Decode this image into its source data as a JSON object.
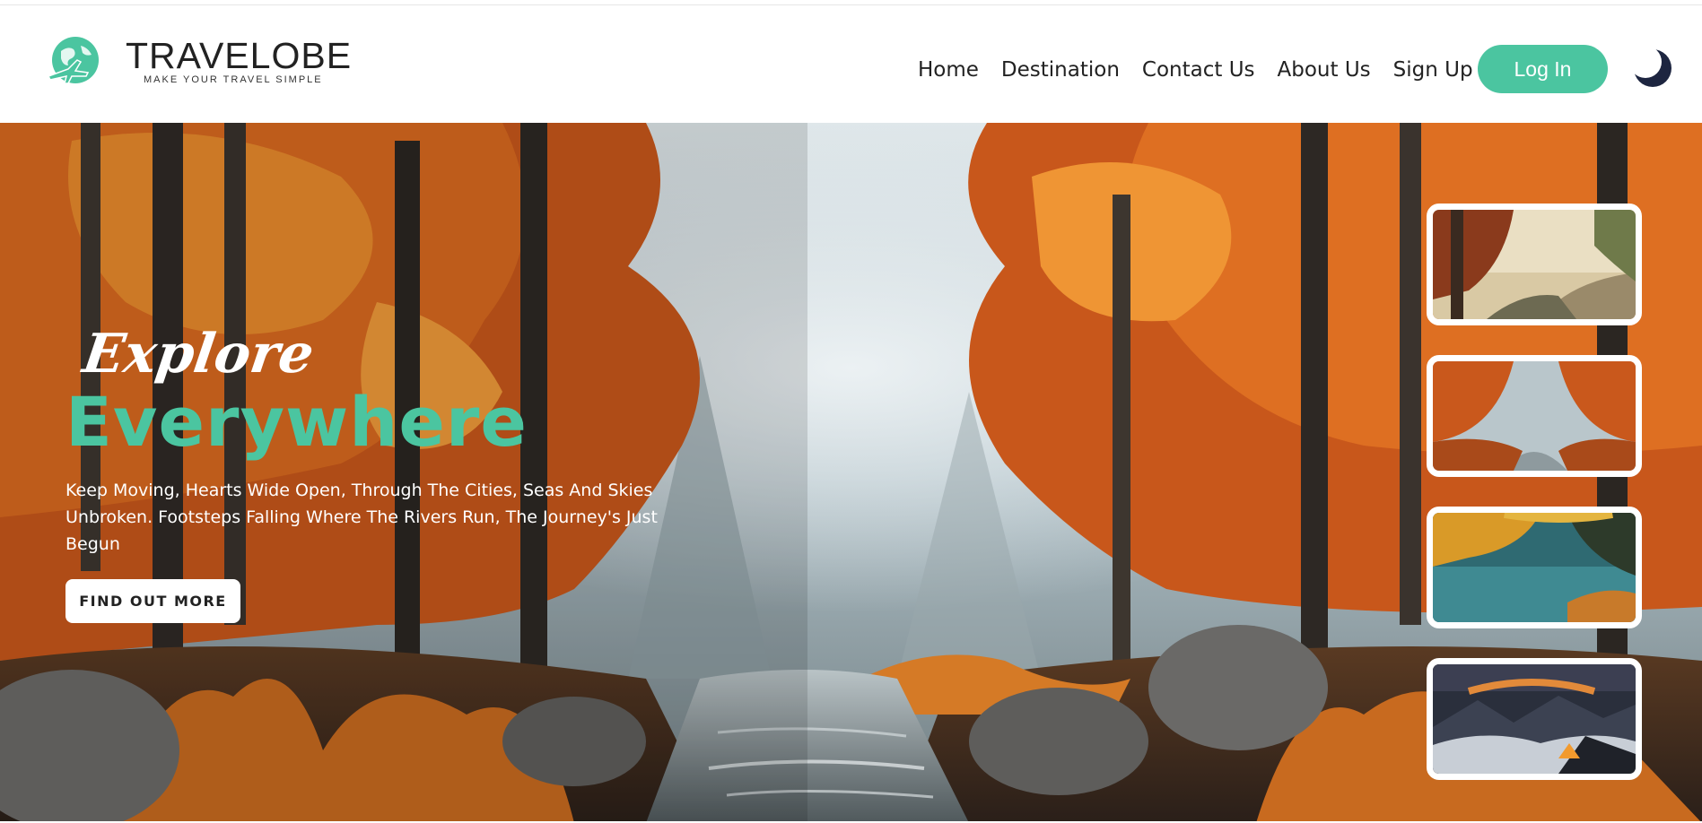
{
  "brand": {
    "name": "TRAVELOBE",
    "tagline": "MAKE YOUR TRAVEL SIMPLE",
    "logo_icon": "globe-plane-icon",
    "accent_color": "#4bc5a0"
  },
  "nav": {
    "links": [
      "Home",
      "Destination",
      "Contact Us",
      "About Us",
      "Sign Up"
    ],
    "login_label": "Log In",
    "theme_icon": "moon-icon"
  },
  "hero": {
    "script_title": "Explore",
    "main_title": "Everywhere",
    "description": "Keep Moving, Hearts Wide Open, Through The Cities, Seas And Skies Unbroken. Footsteps Falling Where The Rivers Run, The Journey's Just Begun",
    "cta_label": "FIND OUT MORE"
  },
  "thumbnails": [
    {
      "name": "misty-forest-path"
    },
    {
      "name": "autumn-forest-river"
    },
    {
      "name": "autumn-lake"
    },
    {
      "name": "mountain-camp-sunset"
    }
  ]
}
